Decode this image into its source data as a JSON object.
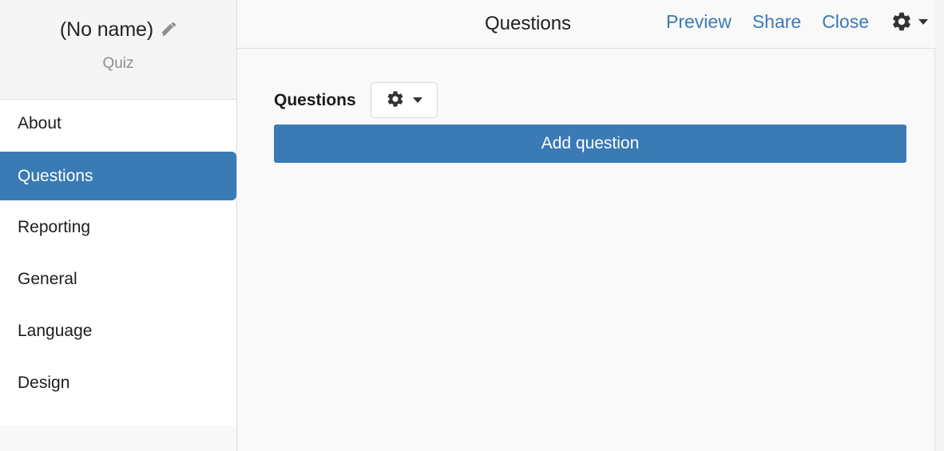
{
  "sidebar": {
    "quiz_name": "(No name)",
    "edit_icon": "pencil-icon",
    "type_label": "Quiz",
    "items": [
      {
        "label": "About",
        "selected": false
      },
      {
        "label": "Questions",
        "selected": true
      },
      {
        "label": "Reporting",
        "selected": false
      },
      {
        "label": "General",
        "selected": false
      },
      {
        "label": "Language",
        "selected": false
      },
      {
        "label": "Design",
        "selected": false
      }
    ]
  },
  "topbar": {
    "title": "Questions",
    "preview_label": "Preview",
    "share_label": "Share",
    "close_label": "Close",
    "settings_icon": "gear-icon",
    "settings_caret": "chevron-down-icon"
  },
  "content": {
    "panel_title": "Questions",
    "panel_menu_icon": "gear-icon",
    "panel_menu_caret": "chevron-down-icon",
    "add_question_label": "Add question"
  },
  "colors": {
    "accent_blue": "#3a7ab5",
    "link_blue": "#3a7ab5",
    "sidebar_header_bg": "#f5f5f5",
    "sidebar_list_bg": "#ffffff",
    "content_bg": "#f9f9f9",
    "muted_text": "#8c8c8c",
    "border": "#dcdcdc"
  }
}
